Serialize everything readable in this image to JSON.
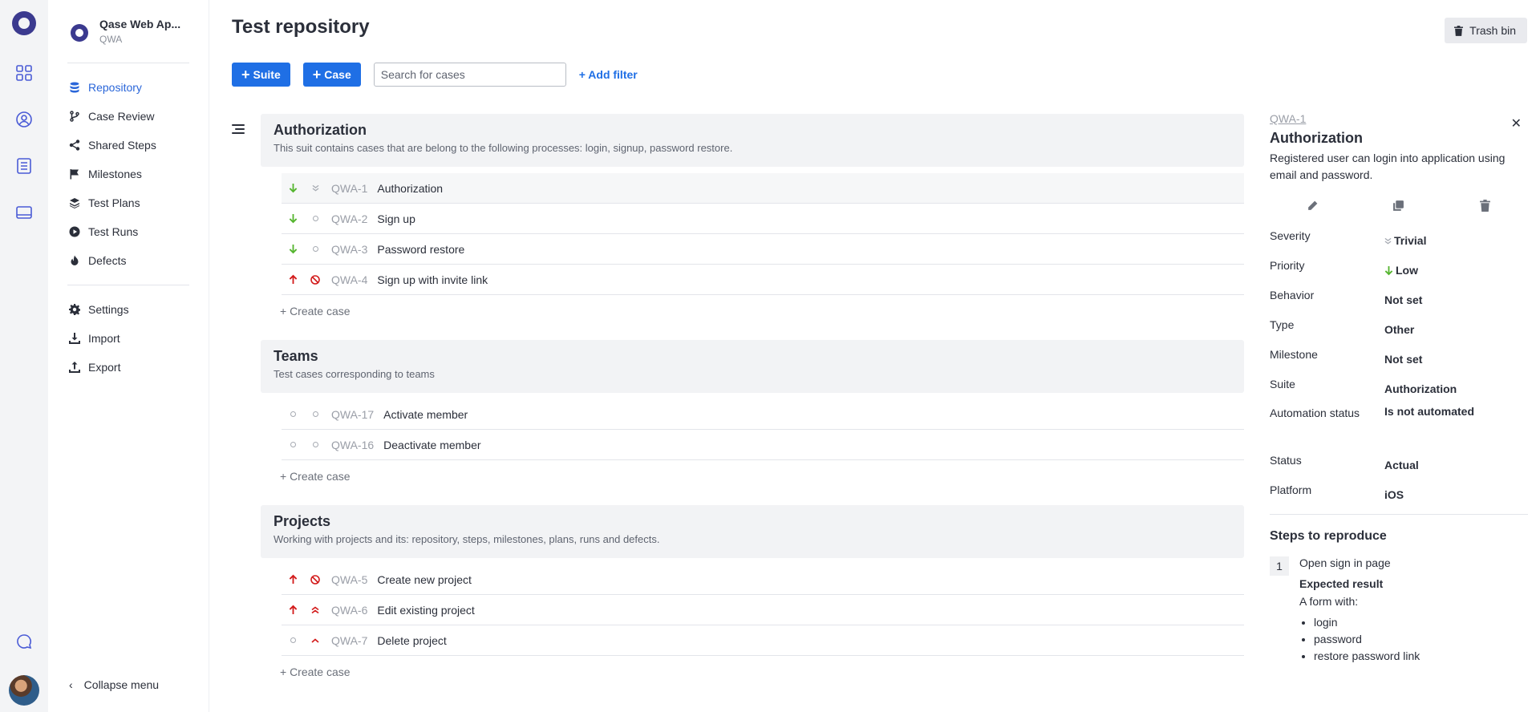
{
  "project": {
    "name": "Qase Web Ap...",
    "code": "QWA"
  },
  "sidebar": {
    "items": [
      {
        "label": "Repository",
        "icon": "database-icon"
      },
      {
        "label": "Case Review",
        "icon": "branch-icon"
      },
      {
        "label": "Shared Steps",
        "icon": "share-icon"
      },
      {
        "label": "Milestones",
        "icon": "flag-icon"
      },
      {
        "label": "Test Plans",
        "icon": "layers-icon"
      },
      {
        "label": "Test Runs",
        "icon": "play-icon"
      },
      {
        "label": "Defects",
        "icon": "flame-icon"
      }
    ],
    "secondary": [
      {
        "label": "Settings",
        "icon": "gear-icon"
      },
      {
        "label": "Import",
        "icon": "download-icon"
      },
      {
        "label": "Export",
        "icon": "upload-icon"
      }
    ],
    "collapse_label": "Collapse menu"
  },
  "header": {
    "title": "Test repository",
    "trash_label": "Trash bin",
    "suite_btn": "Suite",
    "case_btn": "Case",
    "search_placeholder": "Search for cases",
    "add_filter": "+ Add filter"
  },
  "suites": [
    {
      "title": "Authorization",
      "description": "This suit contains cases that are belong to the following processes: login, signup, password restore.",
      "cases": [
        {
          "id": "QWA-1",
          "title": "Authorization"
        },
        {
          "id": "QWA-2",
          "title": "Sign up"
        },
        {
          "id": "QWA-3",
          "title": "Password restore"
        },
        {
          "id": "QWA-4",
          "title": "Sign up with invite link"
        }
      ],
      "create_label": "+ Create case"
    },
    {
      "title": "Teams",
      "description": "Test cases corresponding to teams",
      "cases": [
        {
          "id": "QWA-17",
          "title": "Activate member"
        },
        {
          "id": "QWA-16",
          "title": "Deactivate member"
        }
      ],
      "create_label": "+ Create case"
    },
    {
      "title": "Projects",
      "description": "Working with projects and its: repository, steps, milestones, plans, runs and defects.",
      "cases": [
        {
          "id": "QWA-5",
          "title": "Create new project"
        },
        {
          "id": "QWA-6",
          "title": "Edit existing project"
        },
        {
          "id": "QWA-7",
          "title": "Delete project"
        }
      ],
      "create_label": "+ Create case"
    }
  ],
  "detail": {
    "id": "QWA-1",
    "title": "Authorization",
    "description": "Registered user can login into application using email and password.",
    "properties": [
      {
        "key": "Severity",
        "value": "Trivial"
      },
      {
        "key": "Priority",
        "value": "Low"
      },
      {
        "key": "Behavior",
        "value": "Not set"
      },
      {
        "key": "Type",
        "value": "Other"
      },
      {
        "key": "Milestone",
        "value": "Not set"
      },
      {
        "key": "Suite",
        "value": "Authorization"
      },
      {
        "key": "Automation status",
        "value": "Is not automated"
      },
      {
        "key": "Status",
        "value": "Actual"
      },
      {
        "key": "Platform",
        "value": "iOS"
      }
    ],
    "steps_title": "Steps to reproduce",
    "steps": [
      {
        "number": "1",
        "action": "Open sign in page",
        "expected_label": "Expected result",
        "expected_text": "A form with:",
        "expected_items": [
          "login",
          "password",
          "restore password link"
        ]
      }
    ]
  },
  "colors": {
    "accent": "#1f6fe5",
    "low": "#55b52f",
    "high": "#d31c1c",
    "brand": "#3b3a8f"
  }
}
